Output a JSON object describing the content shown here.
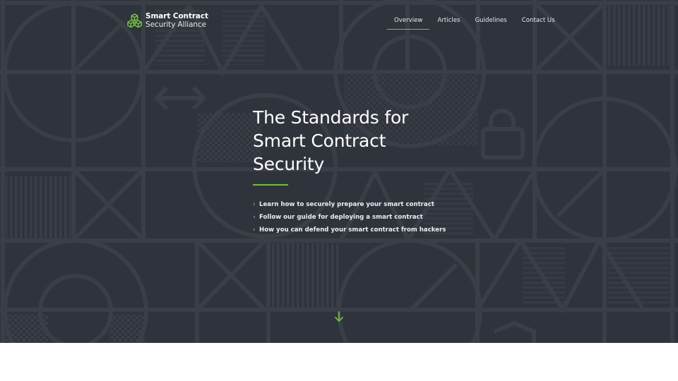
{
  "brand": {
    "name_line1": "Smart Contract",
    "name_line2": "Security Alliance",
    "icon": "cubes-logo-icon",
    "accent_color": "#6fbf40"
  },
  "nav": {
    "items": [
      {
        "label": "Overview",
        "active": true
      },
      {
        "label": "Articles",
        "active": false
      },
      {
        "label": "Guidelines",
        "active": false
      },
      {
        "label": "Contact Us",
        "active": false
      }
    ]
  },
  "hero": {
    "title_lines": [
      "The Standards for",
      "Smart Contract",
      "Security"
    ],
    "bullets": [
      "Learn how to securely prepare your smart contract",
      "Follow our guide for deploying a smart contract",
      "How you can defend your smart contract from hackers"
    ],
    "bullet_icon": "chevron-right-icon",
    "scroll_icon": "arrow-down-icon",
    "background_color": "#2f333b",
    "pattern_color": "#3a3e47"
  }
}
